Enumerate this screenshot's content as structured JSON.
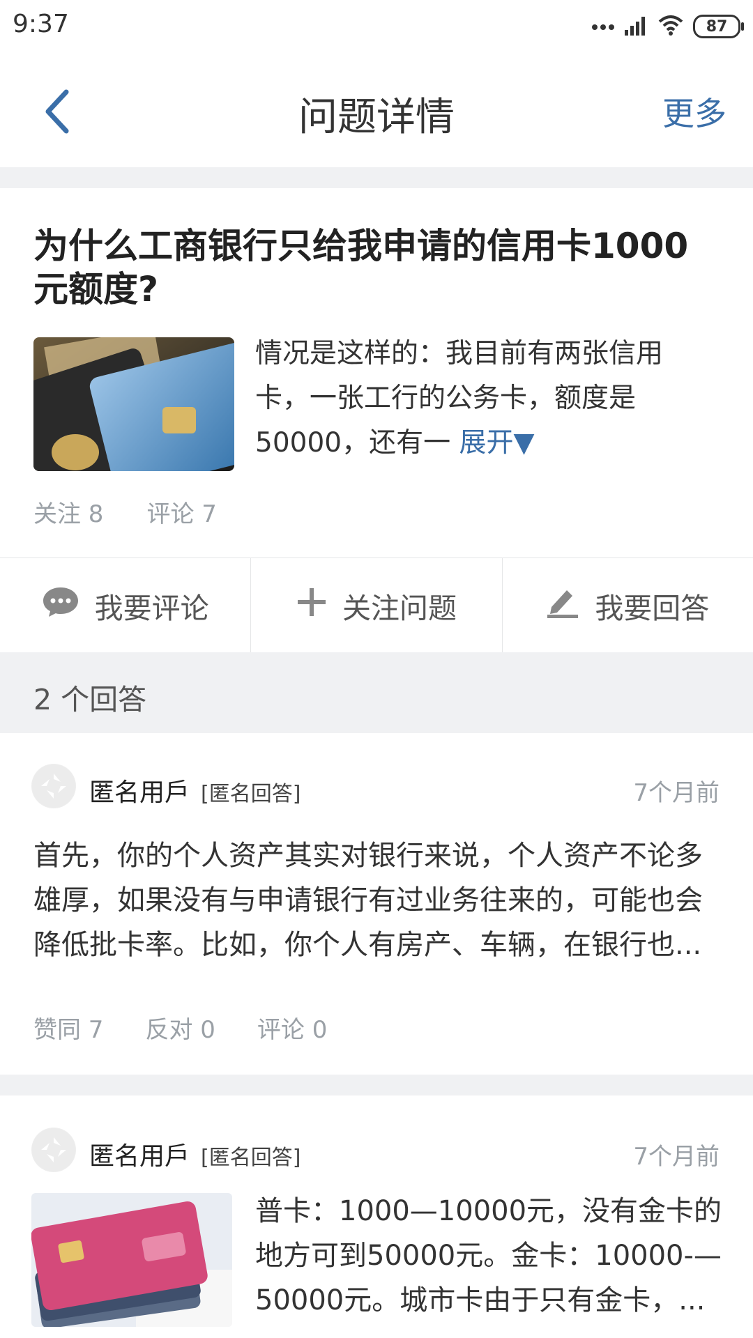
{
  "status_bar": {
    "time": "9:37",
    "battery": "87"
  },
  "nav": {
    "title": "问题详情",
    "more": "更多"
  },
  "question": {
    "title": "为什么工商银行只给我申请的信用卡1000元额度?",
    "body": "情况是这样的：我目前有两张信用卡，一张工行的公务卡，额度是50000，还有一 ",
    "expand": "展开▼",
    "follow": "关注 8",
    "comment": "评论 7"
  },
  "actions": {
    "comment": "我要评论",
    "follow": "关注问题",
    "answer": "我要回答"
  },
  "answers_header": "2 个回答",
  "answers": [
    {
      "author": "匿名用戶",
      "tag": "[匿名回答]",
      "time": "7个月前",
      "body": "首先，你的个人资产其实对银行来说，个人资产不论多雄厚，如果没有与申请银行有过业务往来的，可能也会降低批卡率。比如，你个人有房产、车辆，在银行也...",
      "likes": "赞同 7",
      "against": "反对 0",
      "comments": "评论 0"
    },
    {
      "author": "匿名用戶",
      "tag": "[匿名回答]",
      "time": "7个月前",
      "body": "普卡：1000—10000元，没有金卡的地方可到50000元。金卡：10000-—50000元。城市卡由于只有金卡，..."
    }
  ]
}
